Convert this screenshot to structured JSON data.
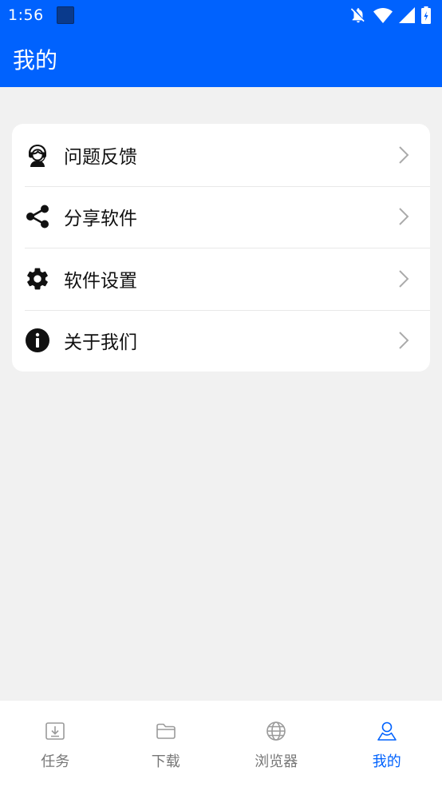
{
  "status_bar": {
    "time": "1:56",
    "icons": [
      "app-notification-icon",
      "bell-off-icon",
      "wifi-icon",
      "signal-icon",
      "battery-icon"
    ]
  },
  "app_bar": {
    "title": "我的"
  },
  "menu": {
    "items": [
      {
        "label": "问题反馈",
        "icon": "headset-icon"
      },
      {
        "label": "分享软件",
        "icon": "share-icon"
      },
      {
        "label": "软件设置",
        "icon": "gear-icon"
      },
      {
        "label": "关于我们",
        "icon": "info-icon"
      }
    ]
  },
  "bottom_nav": {
    "items": [
      {
        "label": "任务",
        "icon": "download-tray-icon",
        "active": false
      },
      {
        "label": "下载",
        "icon": "folder-icon",
        "active": false
      },
      {
        "label": "浏览器",
        "icon": "globe-icon",
        "active": false
      },
      {
        "label": "我的",
        "icon": "user-icon",
        "active": true
      }
    ]
  },
  "colors": {
    "primary": "#0062fe",
    "background": "#f1f1f1",
    "card": "#ffffff",
    "nav_inactive": "#777777",
    "nav_active": "#0062fe"
  }
}
